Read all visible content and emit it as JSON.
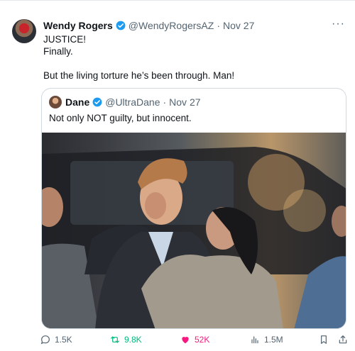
{
  "author": {
    "name": "Wendy Rogers",
    "handle": "@WendyRogersAZ",
    "separator": "·",
    "date": "Nov 27"
  },
  "more_label": "···",
  "body": {
    "line1": "JUSTICE!",
    "line2": "Finally.",
    "line3": "But the living torture he’s been through. Man!"
  },
  "quote": {
    "name": "Dane",
    "handle": "@UltraDane",
    "separator": "·",
    "date": "Nov 27",
    "text": "Not only NOT guilty, but innocent."
  },
  "metrics": {
    "replies": "1.5K",
    "reposts": "9.8K",
    "likes": "52K",
    "views": "1.5M"
  },
  "colors": {
    "verified": "#1d9bf0",
    "repost": "#00ba7c",
    "like": "#f91880",
    "muted": "#536471"
  }
}
